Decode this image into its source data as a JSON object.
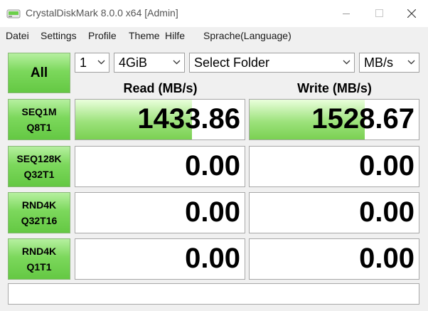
{
  "window": {
    "title": "CrystalDiskMark 8.0.0 x64 [Admin]",
    "icon": "crystaldiskmark-drive-icon"
  },
  "menu": [
    "Datei",
    "Settings",
    "Profile",
    "Theme",
    "Hilfe",
    "Sprache(Language)"
  ],
  "controls": {
    "all_label": "All",
    "count": "1",
    "size": "4GiB",
    "folder": "Select Folder",
    "unit": "MB/s"
  },
  "columns": {
    "read": "Read (MB/s)",
    "write": "Write (MB/s)"
  },
  "tests": [
    {
      "line1": "SEQ1M",
      "line2": "Q8T1",
      "read": "1433.86",
      "write": "1528.67",
      "read_fill": 0.69,
      "write_fill": 0.68
    },
    {
      "line1": "SEQ128K",
      "line2": "Q32T1",
      "read": "0.00",
      "write": "0.00",
      "read_fill": 0,
      "write_fill": 0
    },
    {
      "line1": "RND4K",
      "line2": "Q32T16",
      "read": "0.00",
      "write": "0.00",
      "read_fill": 0,
      "write_fill": 0
    },
    {
      "line1": "RND4K",
      "line2": "Q1T1",
      "read": "0.00",
      "write": "0.00",
      "read_fill": 0,
      "write_fill": 0
    }
  ],
  "status": "",
  "colors": {
    "accent_green": "#7ad052",
    "button_green": "#64c843"
  }
}
